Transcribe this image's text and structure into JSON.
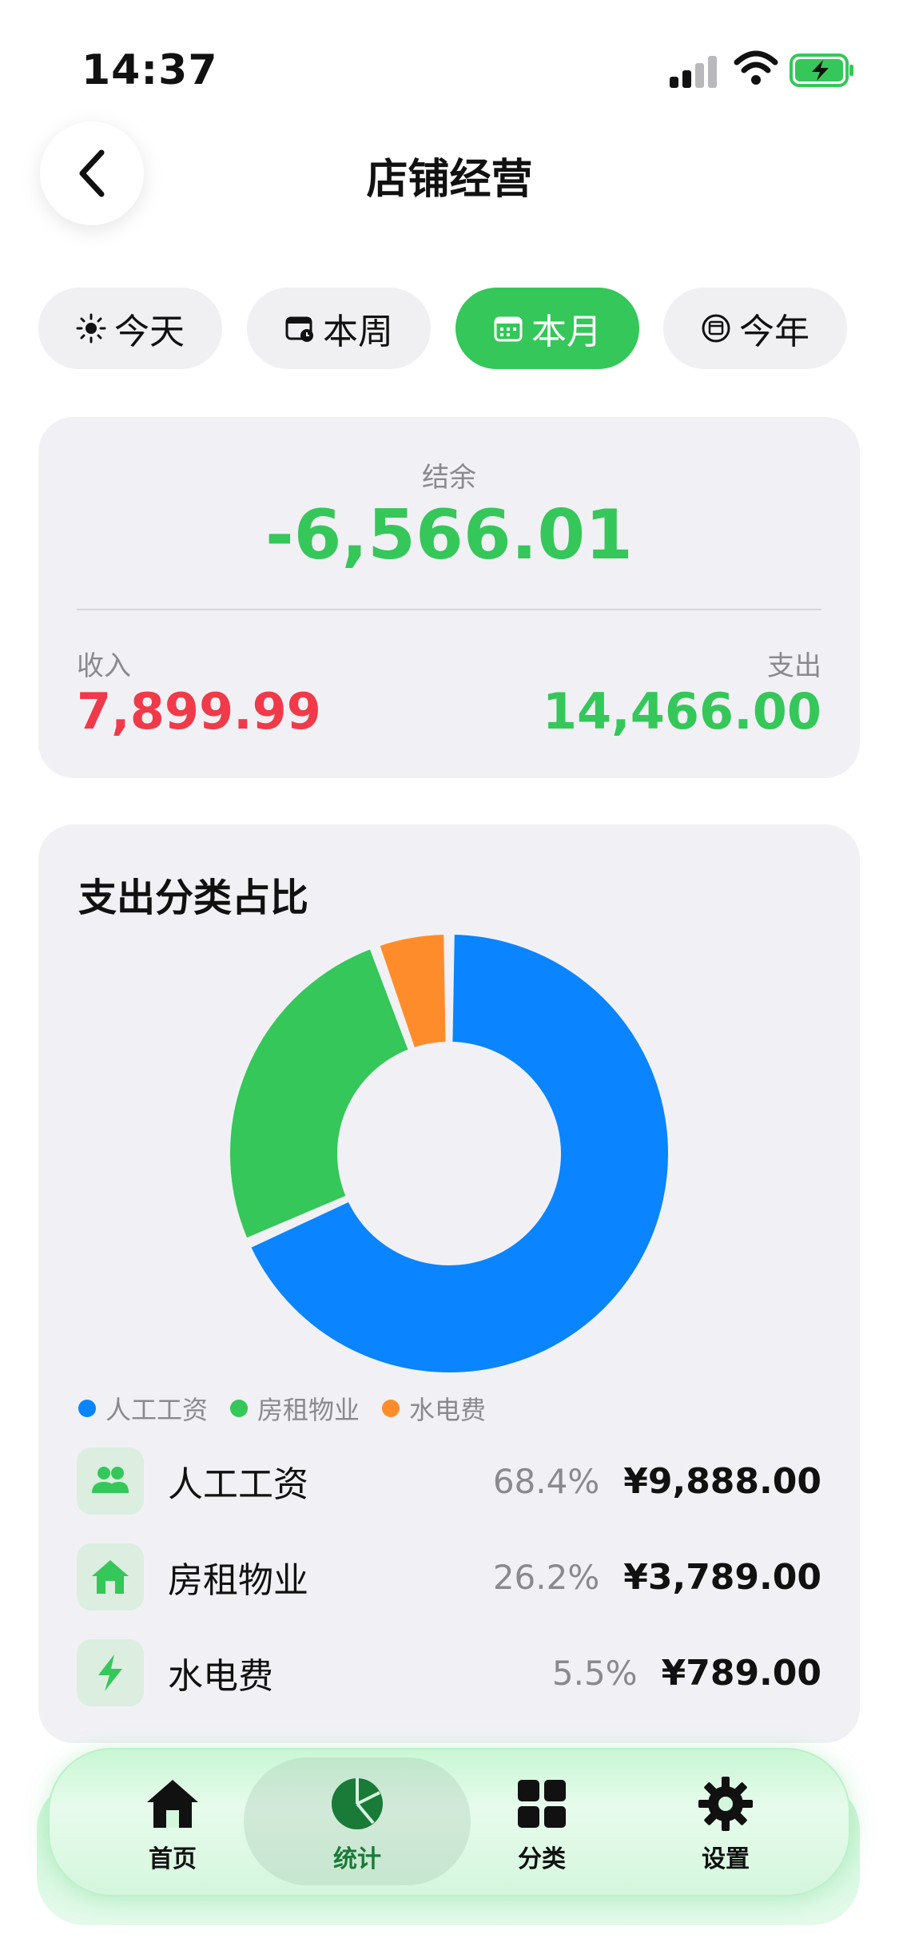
{
  "status_bar": {
    "time": "14:37"
  },
  "header": {
    "title": "店铺经营"
  },
  "tabs": [
    {
      "label": "今天",
      "icon": "sun-icon",
      "active": false
    },
    {
      "label": "本周",
      "icon": "calendar-clock-icon",
      "active": false
    },
    {
      "label": "本月",
      "icon": "calendar-icon",
      "active": true
    },
    {
      "label": "今年",
      "icon": "calendar-circle-icon",
      "active": false
    }
  ],
  "summary": {
    "balance_label": "结余",
    "balance_value": "-6,566.01",
    "income_label": "收入",
    "income_value": "7,899.99",
    "expense_label": "支出",
    "expense_value": "14,466.00"
  },
  "expense_chart": {
    "title": "支出分类占比",
    "legend": [
      "人工工资",
      "房租物业",
      "水电费"
    ]
  },
  "chart_data": {
    "type": "pie",
    "title": "支出分类占比",
    "categories": [
      "人工工资",
      "房租物业",
      "水电费"
    ],
    "values": [
      68.4,
      26.2,
      5.5
    ],
    "colors": [
      "#0a84ff",
      "#35c759",
      "#ff8c2b"
    ],
    "legend_position": "bottom-left"
  },
  "breakdown": [
    {
      "name": "人工工资",
      "percent": "68.4%",
      "amount": "¥9,888.00",
      "icon": "people-icon"
    },
    {
      "name": "房租物业",
      "percent": "26.2%",
      "amount": "¥3,789.00",
      "icon": "house-icon"
    },
    {
      "name": "水电费",
      "percent": "5.5%",
      "amount": "¥789.00",
      "icon": "lightning-icon"
    }
  ],
  "tabbar": [
    {
      "label": "首页",
      "icon": "home-icon"
    },
    {
      "label": "统计",
      "icon": "pie-chart-icon",
      "active": true
    },
    {
      "label": "分类",
      "icon": "grid-icon"
    },
    {
      "label": "设置",
      "icon": "gear-icon"
    }
  ],
  "colors": {
    "accent": "#35c759",
    "income": "#f03a4a",
    "blue": "#0a84ff",
    "orange": "#ff8c2b"
  }
}
